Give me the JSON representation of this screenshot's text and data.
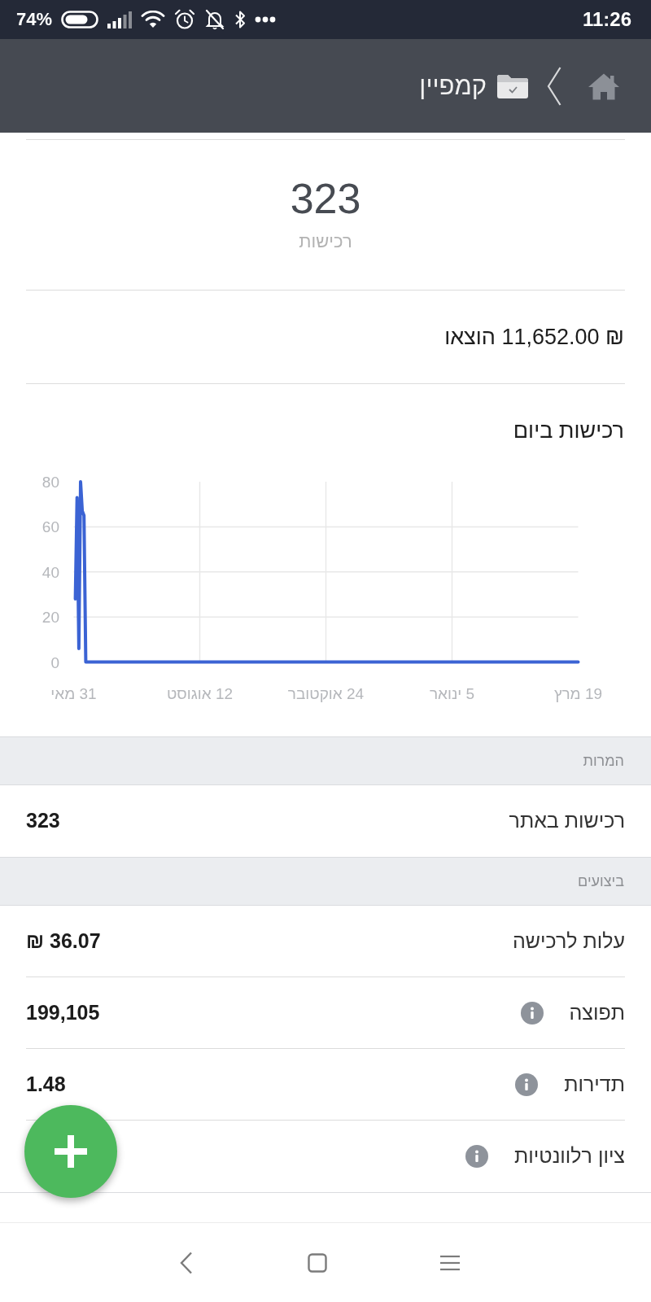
{
  "status_bar": {
    "battery": "74%",
    "time": "11:26"
  },
  "header": {
    "title": "קמפיין"
  },
  "summary": {
    "value": "323",
    "label": "רכישות"
  },
  "spent": "₪ 11,652.00 הוצאו",
  "chart": {
    "chart_data": {
      "type": "line",
      "title": "רכישות ביום",
      "grid": true,
      "ylim": [
        0,
        80
      ],
      "yticks": [
        0,
        20,
        40,
        60,
        80
      ],
      "categories": [
        "31 מאי",
        null,
        null,
        null,
        null,
        null,
        null,
        null,
        null,
        null,
        null,
        null,
        null,
        null,
        null,
        null,
        null,
        null,
        null,
        null,
        null,
        null,
        null,
        null,
        null,
        null,
        null,
        null,
        null,
        null,
        null,
        null,
        null,
        null,
        null,
        null,
        null,
        null,
        null,
        null,
        null,
        null,
        null,
        null,
        null,
        null,
        null,
        null,
        null,
        null,
        null,
        null,
        null,
        null,
        null,
        null,
        null,
        null,
        null,
        null,
        null,
        null,
        null,
        null,
        null,
        null,
        null,
        null,
        null,
        null,
        null,
        null,
        null,
        "12 אוגוסט",
        null,
        null,
        null,
        null,
        null,
        null,
        null,
        null,
        null,
        null,
        null,
        null,
        null,
        null,
        null,
        null,
        null,
        null,
        null,
        null,
        null,
        null,
        null,
        null,
        null,
        null,
        null,
        null,
        null,
        null,
        null,
        null,
        null,
        null,
        null,
        null,
        null,
        null,
        null,
        null,
        null,
        null,
        null,
        null,
        null,
        null,
        null,
        null,
        null,
        null,
        null,
        null,
        null,
        null,
        null,
        null,
        null,
        null,
        null,
        null,
        null,
        null,
        null,
        null,
        null,
        null,
        null,
        null,
        null,
        null,
        null,
        null,
        "24 אוקטובר",
        null,
        null,
        null,
        null,
        null,
        null,
        null,
        null,
        null,
        null,
        null,
        null,
        null,
        null,
        null,
        null,
        null,
        null,
        null,
        null,
        null,
        null,
        null,
        null,
        null,
        null,
        null,
        null,
        null,
        null,
        null,
        null,
        null,
        null,
        null,
        null,
        null,
        null,
        null,
        null,
        null,
        null,
        null,
        null,
        null,
        null,
        null,
        null,
        null,
        null,
        null,
        null,
        null,
        null,
        null,
        null,
        null,
        null,
        null,
        null,
        null,
        null,
        null,
        null,
        null,
        null,
        null,
        null,
        null,
        null,
        null,
        null,
        "5 ינואר",
        null,
        null,
        null,
        null,
        null,
        null,
        null,
        null,
        null,
        null,
        null,
        null,
        null,
        null,
        null,
        null,
        null,
        null,
        null,
        null,
        null,
        null,
        null,
        null,
        null,
        null,
        null,
        null,
        null,
        null,
        null,
        null,
        null,
        null,
        null,
        null,
        null,
        null,
        null,
        null,
        null,
        null,
        null,
        null,
        null,
        null,
        null,
        null,
        null,
        null,
        null,
        null,
        null,
        null,
        null,
        null,
        null,
        null,
        null,
        null,
        null,
        null,
        null,
        null,
        null,
        null,
        null,
        null,
        null,
        null,
        null,
        null,
        "19 מרץ"
      ],
      "series": [
        {
          "color": "#3b63d4",
          "values": [
            null,
            28,
            73,
            6,
            80,
            67,
            65,
            0,
            0,
            0,
            0,
            0,
            0,
            0,
            0,
            0,
            0,
            0,
            0,
            0,
            0,
            0,
            0,
            0,
            0,
            0,
            0,
            0,
            0,
            0,
            0,
            0,
            0,
            0,
            0,
            0,
            0,
            0,
            0,
            0,
            0,
            0,
            0,
            0,
            0,
            0,
            0,
            0,
            0,
            0,
            0,
            0,
            0,
            0,
            0,
            0,
            0,
            0,
            0,
            0,
            0,
            0,
            0,
            0,
            0,
            0,
            0,
            0,
            0,
            0,
            0,
            0,
            0,
            0,
            0,
            0,
            0,
            0,
            0,
            0,
            0,
            0,
            0,
            0,
            0,
            0,
            0,
            0,
            0,
            0,
            0,
            0,
            0,
            0,
            0,
            0,
            0,
            0,
            0,
            0,
            0,
            0,
            0,
            0,
            0,
            0,
            0,
            0,
            0,
            0,
            0,
            0,
            0,
            0,
            0,
            0,
            0,
            0,
            0,
            0,
            0,
            0,
            0,
            0,
            0,
            0,
            0,
            0,
            0,
            0,
            0,
            0,
            0,
            0,
            0,
            0,
            0,
            0,
            0,
            0,
            0,
            0,
            0,
            0,
            0,
            0,
            0,
            0,
            0,
            0,
            0,
            0,
            0,
            0,
            0,
            0,
            0,
            0,
            0,
            0,
            0,
            0,
            0,
            0,
            0,
            0,
            0,
            0,
            0,
            0,
            0,
            0,
            0,
            0,
            0,
            0,
            0,
            0,
            0,
            0,
            0,
            0,
            0,
            0,
            0,
            0,
            0,
            0,
            0,
            0,
            0,
            0,
            0,
            0,
            0,
            0,
            0,
            0,
            0,
            0,
            0,
            0,
            0,
            0,
            0,
            0,
            0,
            0,
            0,
            0,
            0,
            0,
            0,
            0,
            0,
            0,
            0,
            0,
            0,
            0,
            0,
            0,
            0,
            0,
            0,
            0,
            0,
            0,
            0,
            0,
            0,
            0,
            0,
            0,
            0,
            0,
            0,
            0,
            0,
            0,
            0,
            0,
            0,
            0,
            0,
            0,
            0,
            0,
            0,
            0,
            0,
            0,
            0,
            0,
            0,
            0,
            0,
            0,
            0,
            0,
            0,
            0,
            0,
            0,
            0,
            0,
            0,
            0,
            0,
            0,
            0,
            0,
            0,
            0,
            0,
            0,
            0,
            0,
            0,
            0,
            0,
            0,
            0,
            0,
            0,
            0,
            0,
            0,
            0,
            0,
            0,
            0,
            0
          ]
        }
      ]
    }
  },
  "sections": [
    {
      "title": "המרות",
      "rows": [
        {
          "label": "רכישות באתר",
          "value": "323",
          "info": false
        }
      ]
    },
    {
      "title": "ביצועים",
      "rows": [
        {
          "label": "עלות לרכישה",
          "value": "36.07 ₪",
          "info": false
        },
        {
          "label": "תפוצה",
          "value": "199,105",
          "info": true
        },
        {
          "label": "תדירות",
          "value": "1.48",
          "info": true
        },
        {
          "label": "ציון רלוונטיות",
          "info": true
        }
      ]
    }
  ]
}
